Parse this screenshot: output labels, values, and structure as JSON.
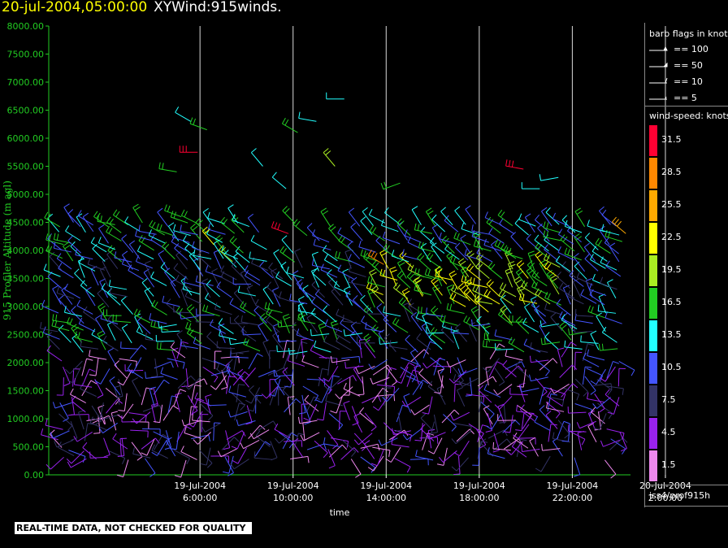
{
  "header": {
    "timestamp": "20-jul-2004,05:00:00",
    "name": "XYWind:915winds."
  },
  "chart_data": {
    "type": "wind-barb time-height plot",
    "title": "20-jul-2004,05:00:00  XYWind:915winds.",
    "xlabel": "time",
    "ylabel": "915 Profiler Altitude (m agl)",
    "ylim": [
      0,
      8000
    ],
    "y_ticks": [
      "0.00",
      "500.00",
      "1000.00",
      "1500.00",
      "2000.00",
      "2500.00",
      "3000.00",
      "3500.00",
      "4000.00",
      "4500.00",
      "5000.00",
      "5500.00",
      "6000.00",
      "6500.00",
      "7000.00",
      "7500.00",
      "8000.00"
    ],
    "xlim_hours": [
      -0.5,
      24.5
    ],
    "x_ticks": [
      {
        "hour": 6,
        "date": "19-Jul-2004",
        "time": "6:00:00"
      },
      {
        "hour": 10,
        "date": "19-Jul-2004",
        "time": "10:00:00"
      },
      {
        "hour": 14,
        "date": "19-Jul-2004",
        "time": "14:00:00"
      },
      {
        "hour": 18,
        "date": "19-Jul-2004",
        "time": "18:00:00"
      },
      {
        "hour": 22,
        "date": "19-Jul-2004",
        "time": "22:00:00"
      },
      {
        "hour": 26,
        "date": "20-Jul-2004",
        "time": "2:00:00"
      }
    ],
    "grid": "vertical lines at time ticks",
    "colors": {
      "axis": "#22cc22",
      "grid": "#ffffff",
      "background": "#000000"
    },
    "speed_scale": [
      {
        "label": "31.5",
        "color": "#ff0033"
      },
      {
        "label": "28.5",
        "color": "#ff8800"
      },
      {
        "label": "25.5",
        "color": "#ffaa00"
      },
      {
        "label": "22.5",
        "color": "#ffff00"
      },
      {
        "label": "19.5",
        "color": "#aaee22"
      },
      {
        "label": "16.5",
        "color": "#22cc22"
      },
      {
        "label": "13.5",
        "color": "#22ffff"
      },
      {
        "label": "10.5",
        "color": "#4455ff"
      },
      {
        "label": "7.5",
        "color": "#333366"
      },
      {
        "label": "4.5",
        "color": "#9922ee"
      },
      {
        "label": "1.5",
        "color": "#ee88ee"
      }
    ],
    "barb_key": [
      "== 100",
      "== 50",
      "== 10",
      "== 5"
    ],
    "series": [
      {
        "name": "1.5",
        "hour": [],
        "altitude_m": [],
        "direction_deg": []
      },
      {
        "name": "4.5",
        "hour": [],
        "altitude_m": [],
        "direction_deg": []
      },
      {
        "name": "7.5",
        "hour": [],
        "altitude_m": [],
        "direction_deg": []
      },
      {
        "name": "10.5",
        "hour": [],
        "altitude_m": [],
        "direction_deg": []
      },
      {
        "name": "13.5",
        "hour": [],
        "altitude_m": [],
        "direction_deg": []
      },
      {
        "name": "16.5",
        "hour": [],
        "altitude_m": [],
        "direction_deg": []
      },
      {
        "name": "19.5",
        "hour": [],
        "altitude_m": [],
        "direction_deg": []
      },
      {
        "name": "22.5",
        "hour": [],
        "altitude_m": [],
        "direction_deg": []
      },
      {
        "name": "25.5",
        "hour": [],
        "altitude_m": [],
        "direction_deg": []
      },
      {
        "name": "28.5",
        "hour": [],
        "altitude_m": [],
        "direction_deg": []
      },
      {
        "name": "31.5",
        "hour": [],
        "altitude_m": [],
        "direction_deg": []
      }
    ],
    "samples": [
      {
        "hour": 5.6,
        "alt": 6300,
        "spd": 13.5,
        "dir": 300
      },
      {
        "hour": 6.3,
        "alt": 6150,
        "spd": 16.5,
        "dir": 290
      },
      {
        "hour": 5.9,
        "alt": 5750,
        "spd": 31.5,
        "dir": 270
      },
      {
        "hour": 5.0,
        "alt": 5400,
        "spd": 16.5,
        "dir": 280
      },
      {
        "hour": 5.2,
        "alt": 4600,
        "spd": 16.5,
        "dir": 290
      },
      {
        "hour": 6.6,
        "alt": 4100,
        "spd": 22.5,
        "dir": 320
      },
      {
        "hour": 7.4,
        "alt": 3800,
        "spd": 19.5,
        "dir": 310
      },
      {
        "hour": 8.2,
        "alt": 3400,
        "spd": 10.5,
        "dir": 270
      },
      {
        "hour": 8.7,
        "alt": 5500,
        "spd": 13.5,
        "dir": 320
      },
      {
        "hour": 9.7,
        "alt": 5100,
        "spd": 13.5,
        "dir": 310
      },
      {
        "hour": 9.8,
        "alt": 4300,
        "spd": 31.5,
        "dir": 290
      },
      {
        "hour": 10.2,
        "alt": 6100,
        "spd": 16.5,
        "dir": 300
      },
      {
        "hour": 11.0,
        "alt": 6300,
        "spd": 13.5,
        "dir": 280
      },
      {
        "hour": 12.2,
        "alt": 6700,
        "spd": 13.5,
        "dir": 270
      },
      {
        "hour": 11.8,
        "alt": 5500,
        "spd": 19.5,
        "dir": 320
      },
      {
        "hour": 13.9,
        "alt": 3750,
        "spd": 28.5,
        "dir": 300
      },
      {
        "hour": 14.6,
        "alt": 5200,
        "spd": 16.5,
        "dir": 250
      },
      {
        "hour": 15.6,
        "alt": 3200,
        "spd": 19.5,
        "dir": 330
      },
      {
        "hour": 16.6,
        "alt": 3400,
        "spd": 22.5,
        "dir": 320
      },
      {
        "hour": 17.6,
        "alt": 3100,
        "spd": 22.5,
        "dir": 320
      },
      {
        "hour": 18.4,
        "alt": 2900,
        "spd": 22.5,
        "dir": 310
      },
      {
        "hour": 19.4,
        "alt": 2700,
        "spd": 19.5,
        "dir": 320
      },
      {
        "hour": 19.9,
        "alt": 5450,
        "spd": 31.5,
        "dir": 280
      },
      {
        "hour": 20.6,
        "alt": 5100,
        "spd": 13.5,
        "dir": 270
      },
      {
        "hour": 21.4,
        "alt": 5300,
        "spd": 13.5,
        "dir": 260
      },
      {
        "hour": 22.2,
        "alt": 2600,
        "spd": 13.5,
        "dir": 300
      },
      {
        "hour": 23.4,
        "alt": 2800,
        "spd": 16.5,
        "dir": 290
      },
      {
        "hour": 24.3,
        "alt": 4300,
        "spd": 25.5,
        "dir": 310
      },
      {
        "hour": 25.4,
        "alt": 4600,
        "spd": 28.5,
        "dir": 290
      },
      {
        "hour": 26.5,
        "alt": 4800,
        "spd": 25.5,
        "dir": 300
      },
      {
        "hour": 27.4,
        "alt": 4600,
        "spd": 22.5,
        "dir": 310
      },
      {
        "hour": 28.6,
        "alt": 4700,
        "spd": 22.5,
        "dir": 300
      },
      {
        "hour": 25.8,
        "alt": 3800,
        "spd": 19.5,
        "dir": 320
      },
      {
        "hour": 27.8,
        "alt": 3300,
        "spd": 10.5,
        "dir": 300
      }
    ]
  },
  "legend": {
    "barb_header": "barb flags in knots",
    "speed_header": "wind-speed: knots",
    "station": "iss4/prof915h"
  },
  "footer": {
    "disclaimer": "REAL-TIME DATA, NOT CHECKED FOR QUALITY"
  }
}
